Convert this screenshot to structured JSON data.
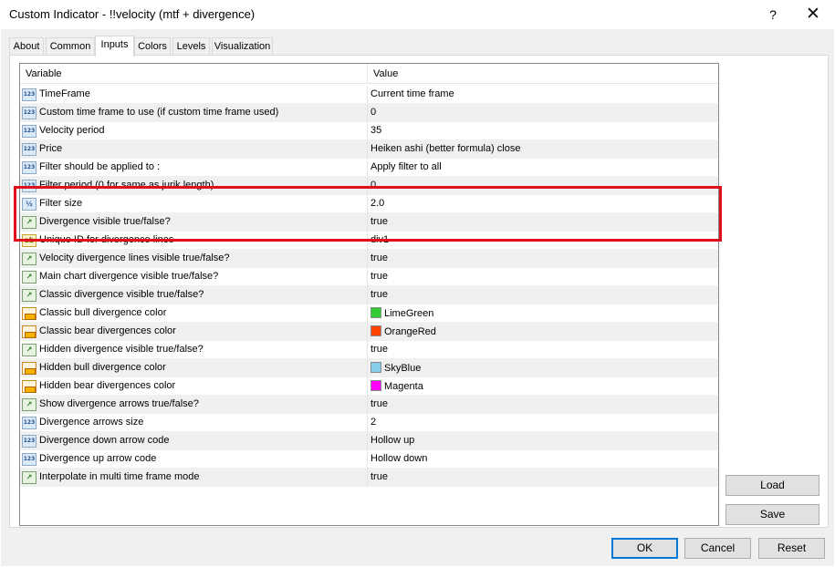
{
  "window": {
    "title": "Custom Indicator - !!velocity (mtf + divergence)",
    "help_label": "?",
    "close_label": "✕"
  },
  "tabs": [
    {
      "label": "About"
    },
    {
      "label": "Common"
    },
    {
      "label": "Inputs",
      "active": true
    },
    {
      "label": "Colors"
    },
    {
      "label": "Levels"
    },
    {
      "label": "Visualization"
    }
  ],
  "grid": {
    "header_variable": "Variable",
    "header_value": "Value",
    "rows": [
      {
        "icon": "int-icon",
        "variable": "TimeFrame",
        "value": "Current time frame"
      },
      {
        "icon": "int-icon",
        "variable": "Custom time frame to use (if custom time frame used)",
        "value": "0"
      },
      {
        "icon": "int-icon",
        "variable": "Velocity period",
        "value": "35"
      },
      {
        "icon": "int-icon",
        "variable": "Price",
        "value": "Heiken ashi (better formula) close"
      },
      {
        "icon": "int-icon",
        "variable": "Filter should be applied to :",
        "value": "Apply filter to all"
      },
      {
        "icon": "int-icon",
        "variable": "Filter period (0 for same as jurik length)",
        "value": "0"
      },
      {
        "icon": "double-icon",
        "variable": "Filter size",
        "value": "2.0"
      },
      {
        "icon": "bool-icon",
        "variable": "Divergence visible true/false?",
        "value": "true"
      },
      {
        "icon": "string-icon",
        "variable": "Unique ID for divergence lines",
        "value": "div1"
      },
      {
        "icon": "bool-icon",
        "variable": "Velocity divergence lines visible true/false?",
        "value": "true"
      },
      {
        "icon": "bool-icon",
        "variable": "Main chart divergence visible true/false?",
        "value": "true"
      },
      {
        "icon": "bool-icon",
        "variable": "Classic divergence visible true/false?",
        "value": "true"
      },
      {
        "icon": "color-icon",
        "variable": "Classic bull divergence color",
        "value": "LimeGreen",
        "swatch": "#32cd32"
      },
      {
        "icon": "color-icon",
        "variable": "Classic bear divergences color",
        "value": "OrangeRed",
        "swatch": "#ff4500"
      },
      {
        "icon": "bool-icon",
        "variable": "Hidden divergence visible true/false?",
        "value": "true"
      },
      {
        "icon": "color-icon",
        "variable": "Hidden bull divergence color",
        "value": "SkyBlue",
        "swatch": "#87ceeb"
      },
      {
        "icon": "color-icon",
        "variable": "Hidden bear divergences color",
        "value": "Magenta",
        "swatch": "#ff00ff"
      },
      {
        "icon": "bool-icon",
        "variable": "Show divergence arrows true/false?",
        "value": "true"
      },
      {
        "icon": "int-icon",
        "variable": "Divergence arrows size",
        "value": "2"
      },
      {
        "icon": "int-icon",
        "variable": "Divergence down arrow code",
        "value": "Hollow up"
      },
      {
        "icon": "int-icon",
        "variable": "Divergence up arrow code",
        "value": "Hollow down"
      },
      {
        "icon": "bool-icon",
        "variable": "Interpolate in multi time frame mode",
        "value": "true"
      }
    ]
  },
  "side_buttons": {
    "load": "Load",
    "save": "Save"
  },
  "footer_buttons": {
    "ok": "OK",
    "cancel": "Cancel",
    "reset": "Reset"
  },
  "colors": {
    "highlight": "#e0101b",
    "default_button_border": "#0078d7"
  }
}
